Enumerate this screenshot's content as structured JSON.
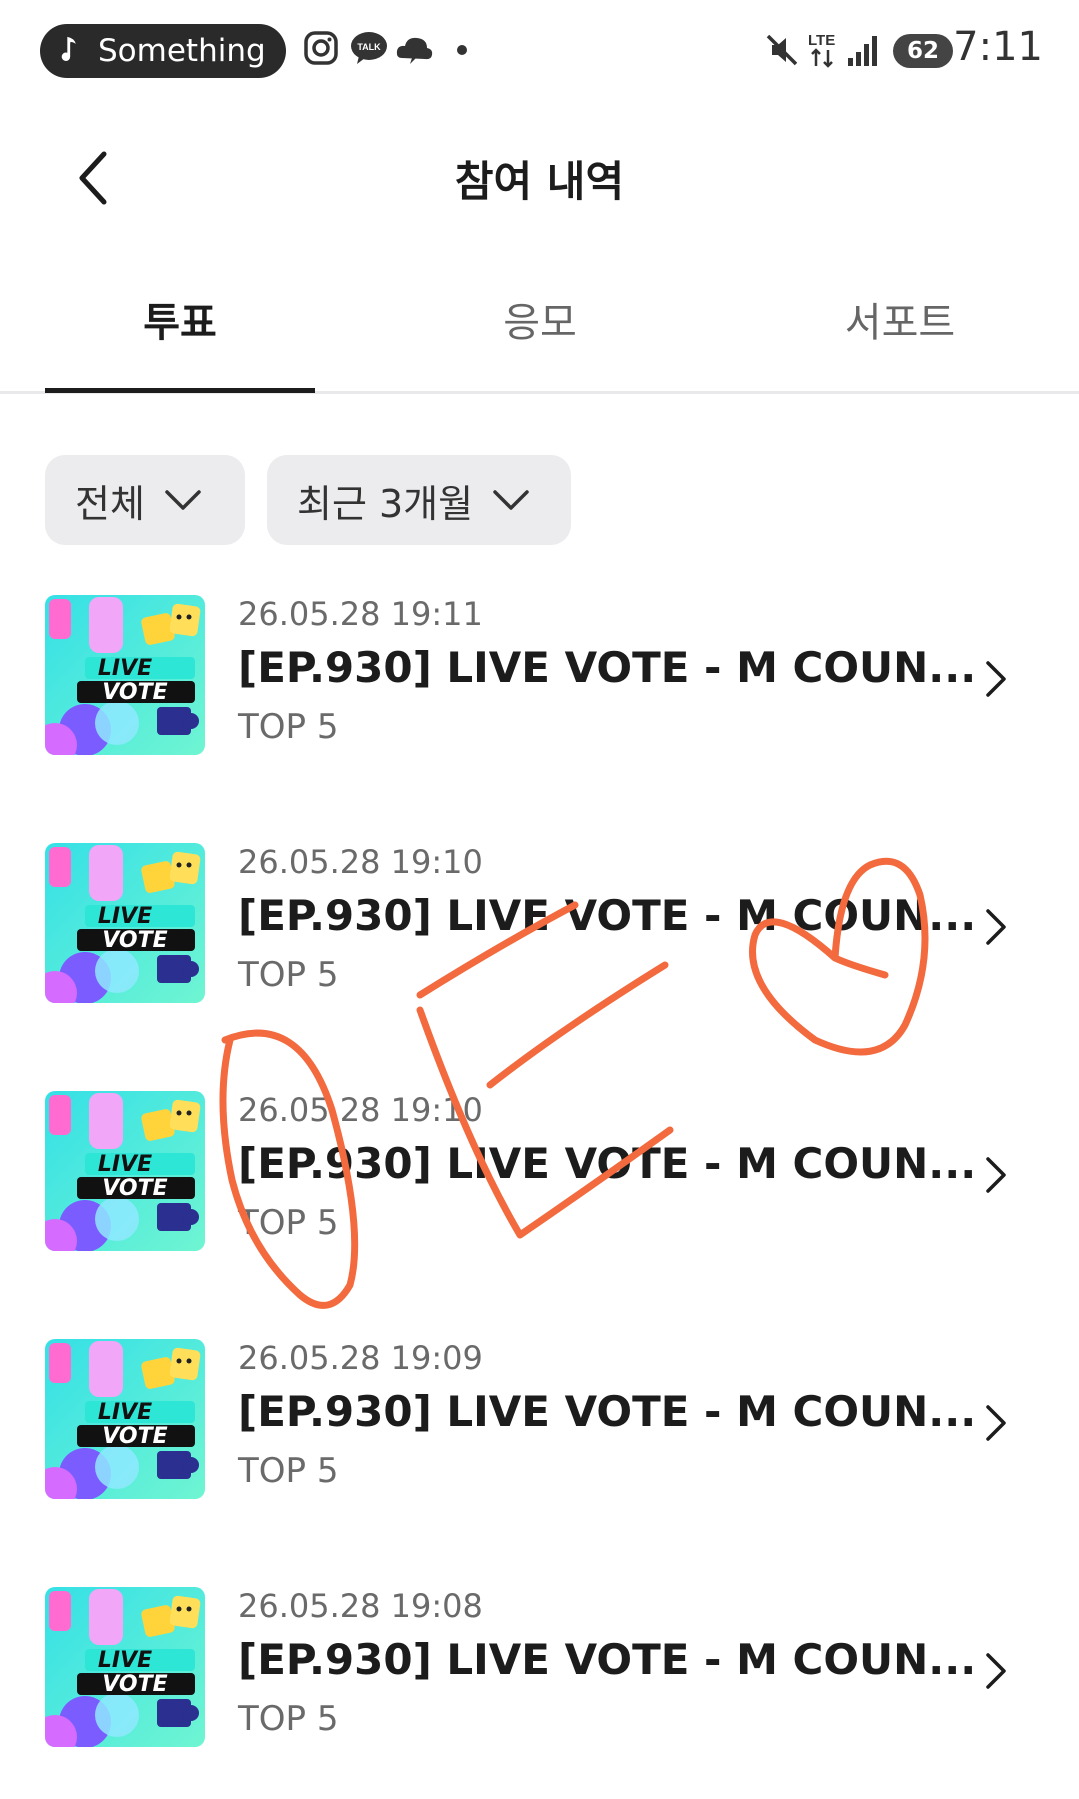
{
  "status_bar": {
    "now_playing": "Something",
    "time": "7:11",
    "battery": "62",
    "network": "LTE",
    "icons": [
      "music-note-icon",
      "instagram-icon",
      "kakaotalk-icon",
      "weather-icon",
      "dot-icon",
      "mute-icon",
      "lte-icon",
      "signal-icon",
      "battery-icon"
    ]
  },
  "header": {
    "title": "참여 내역",
    "back_icon": "chevron-left-icon"
  },
  "tabs": [
    {
      "label": "투표",
      "active": true
    },
    {
      "label": "응모",
      "active": false
    },
    {
      "label": "서포트",
      "active": false
    }
  ],
  "filters": {
    "category": "전체",
    "period": "최근 3개월"
  },
  "items": [
    {
      "date": "26.05.28 19:11",
      "title": "[EP.930] LIVE VOTE - M COUN...",
      "subtitle": "TOP 5"
    },
    {
      "date": "26.05.28 19:10",
      "title": "[EP.930] LIVE VOTE - M COUN...",
      "subtitle": "TOP 5"
    },
    {
      "date": "26.05.28 19:10",
      "title": "[EP.930] LIVE VOTE - M COUN...",
      "subtitle": "TOP 5"
    },
    {
      "date": "26.05.28 19:09",
      "title": "[EP.930] LIVE VOTE - M COUN...",
      "subtitle": "TOP 5"
    },
    {
      "date": "26.05.28 19:08",
      "title": "[EP.930] LIVE VOTE - M COUN...",
      "subtitle": "TOP 5"
    }
  ],
  "thumbnail": {
    "line1": "LIVE",
    "line2": "VOTE"
  },
  "colors": {
    "text_primary": "#1c1c1c",
    "text_secondary": "#6a6a6a",
    "chip_bg": "#ececef",
    "scribble": "#f26a3d"
  }
}
